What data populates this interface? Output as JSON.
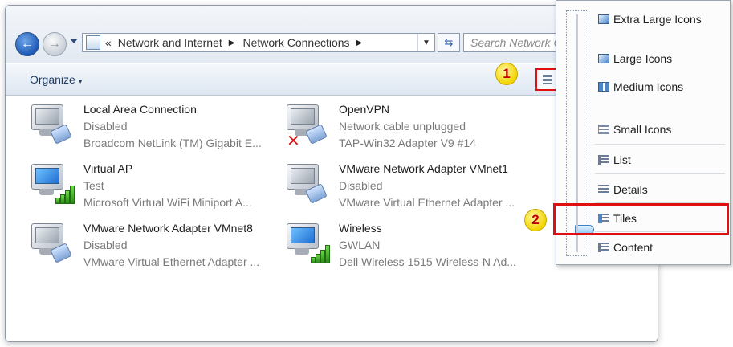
{
  "address_bar": {
    "chevron": "«",
    "segments": [
      "Network and Internet",
      "Network Connections"
    ],
    "search_placeholder": "Search Network C"
  },
  "commandbar": {
    "organize_label": "Organize",
    "organize_caret": "▾"
  },
  "callouts": {
    "one": "1",
    "two": "2"
  },
  "connections": [
    {
      "name": "Local Area Connection",
      "status": "Disabled",
      "device": "Broadcom NetLink (TM) Gigabit E...",
      "icon": "wired-network-icon"
    },
    {
      "name": "OpenVPN",
      "status": "Network cable unplugged",
      "device": "TAP-Win32 Adapter V9 #14",
      "icon": "wired-network-icon"
    },
    {
      "name": "Virtual AP",
      "status": "Test",
      "device": "Microsoft Virtual WiFi Miniport A...",
      "icon": "wireless-network-icon"
    },
    {
      "name": "VMware Network Adapter VMnet1",
      "status": "Disabled",
      "device": "VMware Virtual Ethernet Adapter ...",
      "icon": "wired-network-icon"
    },
    {
      "name": "VMware Network Adapter VMnet8",
      "status": "Disabled",
      "device": "VMware Virtual Ethernet Adapter ...",
      "icon": "wired-network-icon"
    },
    {
      "name": "Wireless",
      "status": "GWLAN",
      "device": "Dell Wireless 1515 Wireless-N Ad...",
      "icon": "wireless-network-icon"
    }
  ],
  "view_menu": {
    "items": [
      "Extra Large Icons",
      "Large Icons",
      "Medium Icons",
      "Small Icons",
      "List",
      "Details",
      "Tiles",
      "Content"
    ],
    "selected": "Tiles"
  },
  "colors": {
    "highlight": "#e01010",
    "badge": "#f3d400"
  }
}
